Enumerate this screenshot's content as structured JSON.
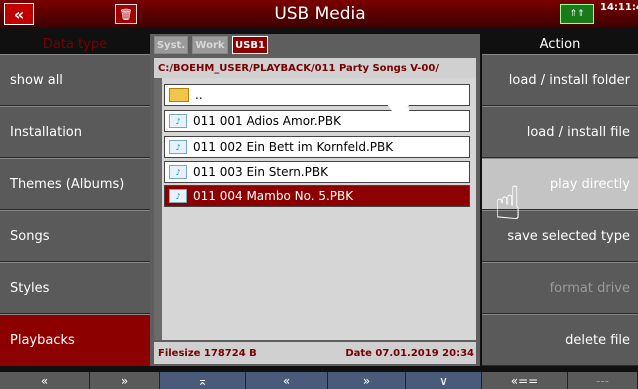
{
  "header": {
    "back_icon": "«",
    "trash_icon": "🗑",
    "title": "USB Media",
    "usb_icon": "usb-icon",
    "clock": "14:11:4"
  },
  "left": {
    "heading": "Data type",
    "items": [
      {
        "label": "show all"
      },
      {
        "label": "Installation"
      },
      {
        "label": "Themes (Albums)"
      },
      {
        "label": "Songs"
      },
      {
        "label": "Styles"
      },
      {
        "label": "Playbacks",
        "active": true
      }
    ]
  },
  "center": {
    "tabs": [
      {
        "label": "Syst."
      },
      {
        "label": "Work"
      },
      {
        "label": "USB1",
        "active": true
      }
    ],
    "path": "C:/BOEHM_USER/PLAYBACK/011 Party Songs V-00/",
    "parent": "..",
    "files": [
      {
        "name": "011 001 Adios Amor.PBK"
      },
      {
        "name": "011 002 Ein Bett im Kornfeld.PBK"
      },
      {
        "name": "011 003 Ein Stern.PBK"
      },
      {
        "name": "011 004 Mambo No. 5.PBK",
        "selected": true
      }
    ],
    "filesize": "Filesize  178724 B",
    "date": "Date  07.01.2019   20:34"
  },
  "right": {
    "heading": "Action",
    "items": [
      {
        "label": "load  /  install  folder"
      },
      {
        "label": "load  /  install  file"
      },
      {
        "label": "play  directly",
        "highlighted": true
      },
      {
        "label": "save  selected  type"
      },
      {
        "label": "format  drive",
        "disabled": true
      },
      {
        "label": "delete  file"
      }
    ]
  },
  "bottom": {
    "buttons": [
      "«",
      "»",
      "⌅",
      "«",
      "»",
      "∨",
      "«==",
      "---"
    ]
  }
}
